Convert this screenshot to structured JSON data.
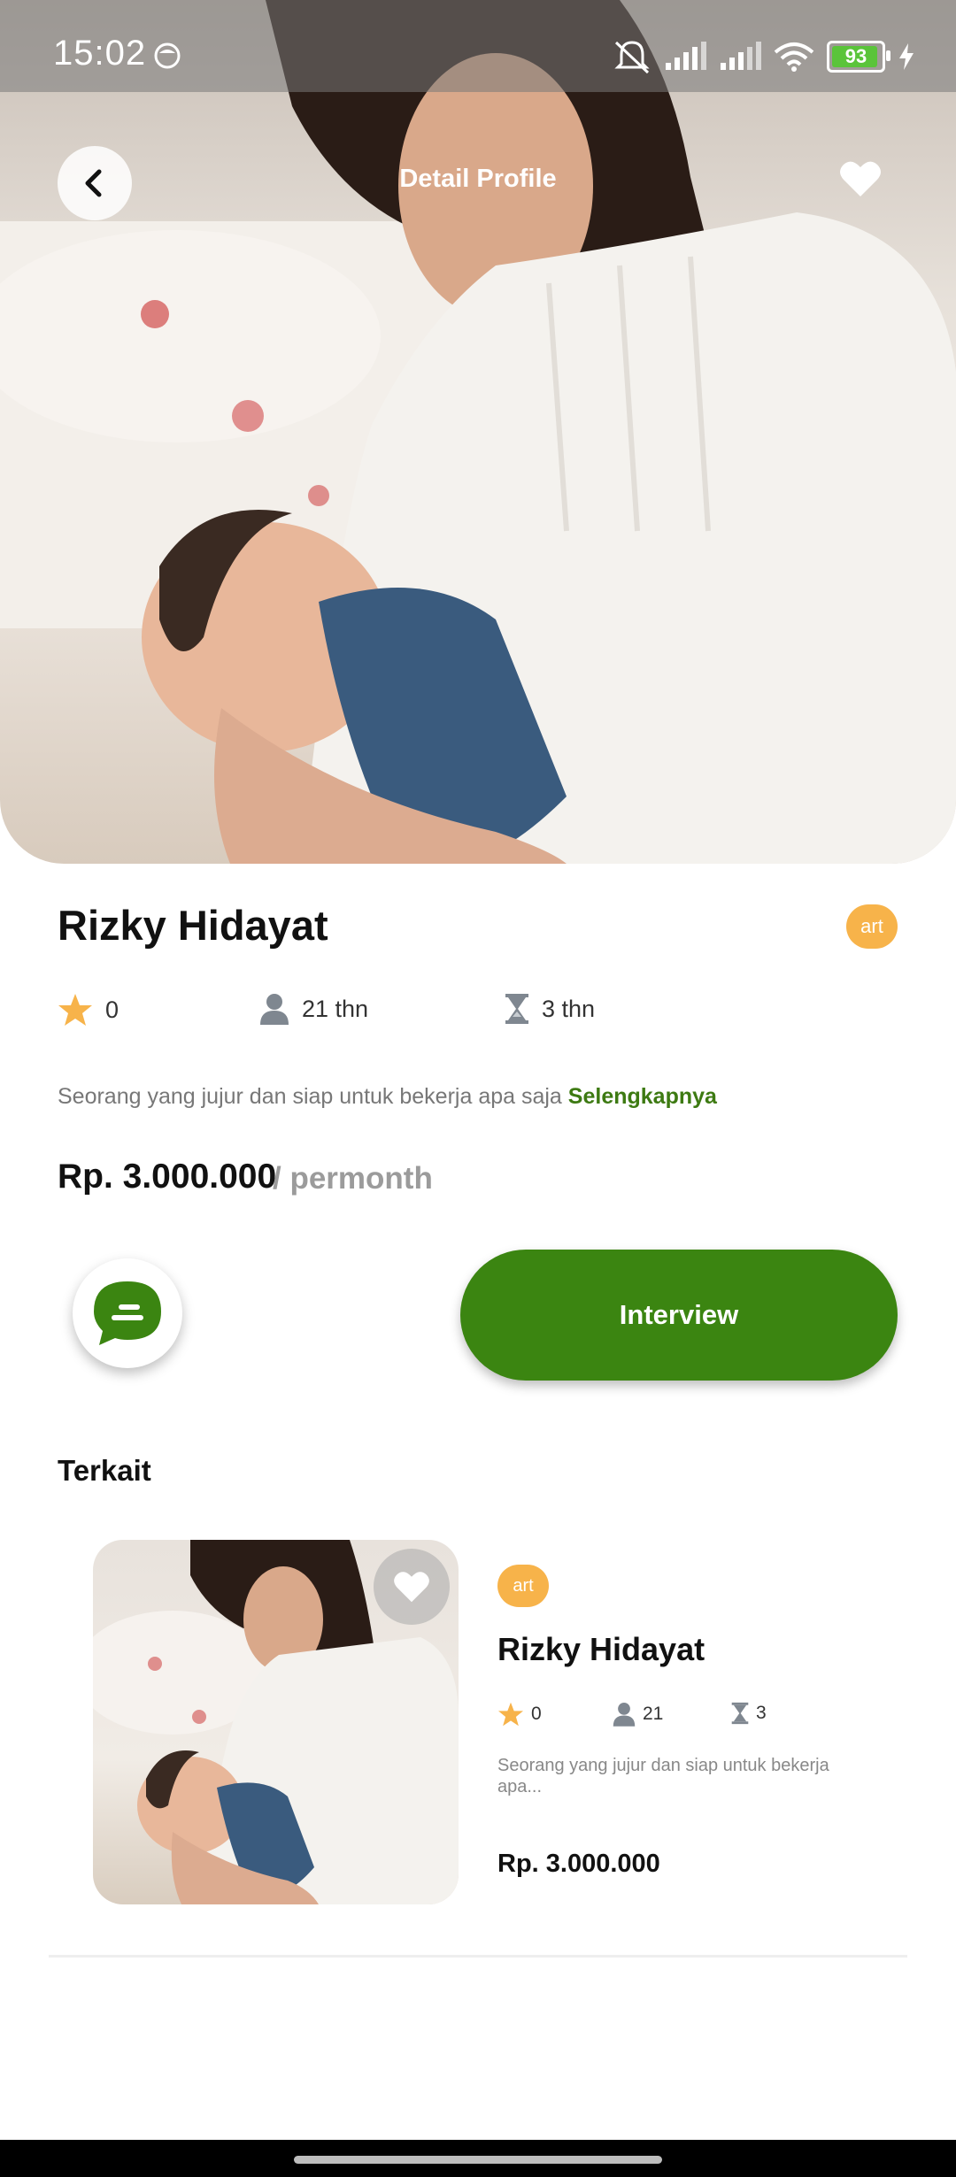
{
  "status_bar": {
    "time": "15:02",
    "battery_level": "93"
  },
  "header": {
    "title": "Detail Profile",
    "back_icon": "chevron-left-icon",
    "favorite_icon": "heart-icon"
  },
  "profile": {
    "name": "Rizky Hidayat",
    "badge": "art",
    "rating": "0",
    "age": "21 thn",
    "experience": "3 thn",
    "description": "Seorang yang jujur dan siap untuk bekerja apa saja",
    "read_more": "Selengkapnya",
    "price": "Rp. 3.000.000",
    "price_unit": "/ permonth"
  },
  "actions": {
    "chat_icon": "chat-bubble-icon",
    "interview_label": "Interview"
  },
  "related": {
    "section_title": "Terkait",
    "items": [
      {
        "badge": "art",
        "name": "Rizky Hidayat",
        "rating": "0",
        "age": "21",
        "experience": "3",
        "description": "Seorang yang jujur dan siap untuk bekerja apa...",
        "price": "Rp. 3.000.000"
      }
    ]
  },
  "colors": {
    "primary_green": "#3b8511",
    "badge_orange": "#f7b34a",
    "star_yellow": "#f7b34a"
  }
}
